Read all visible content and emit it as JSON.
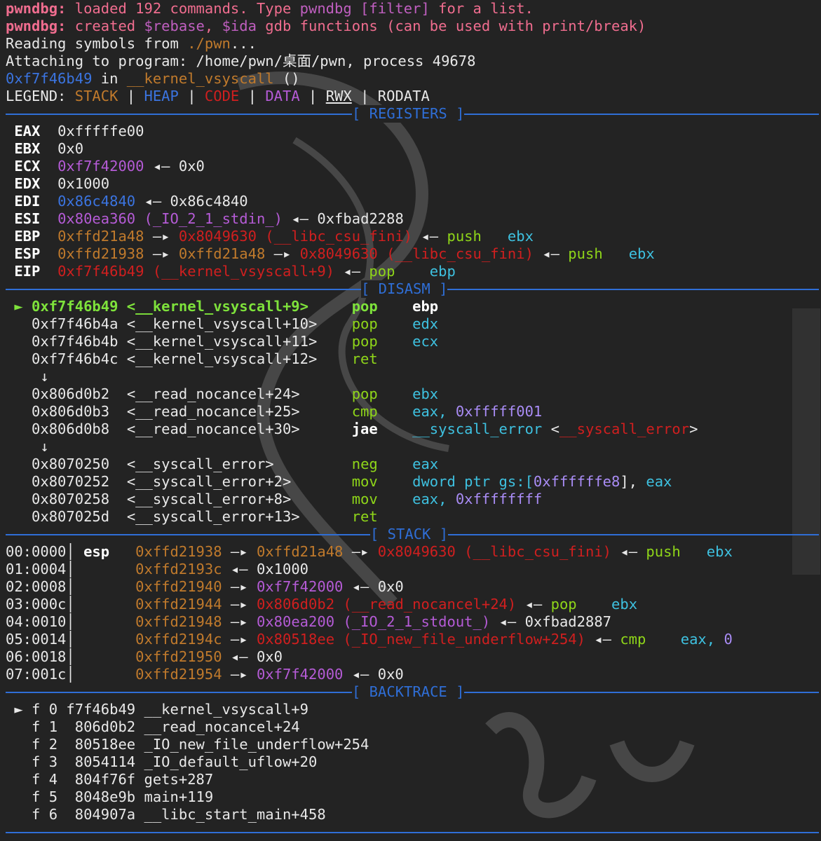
{
  "colors": {
    "background": "#232323",
    "separator": "#2f6ed6",
    "stack": "#c07a2c",
    "heap": "#3b74e0",
    "code": "#d01f1f",
    "data": "#b55bd6",
    "current": "#7ee23b"
  },
  "header": {
    "l1_prompt": "pwndbg:",
    "l1_a": " loaded 192 commands. Type ",
    "l1_b": "pwndbg [filter]",
    "l1_c": " for a list.",
    "l2_prompt": "pwndbg:",
    "l2_a": " created ",
    "l2_b": "$rebase",
    "l2_c": ", ",
    "l2_d": "$ida",
    "l2_e": " gdb functions (can be used with print/break)",
    "l3_a": "Reading symbols from ",
    "l3_b": "./pwn",
    "l3_c": "...",
    "l4": "Attaching to program: /home/pwn/桌面/pwn, process 49678",
    "l5_addr": "0xf7f46b49",
    "l5_in": " in ",
    "l5_func": "__kernel_vsyscall",
    "l5_tail": " ()",
    "legend_label": "LEGEND: ",
    "legend_stack": "STACK",
    "legend_heap": "HEAP",
    "legend_code": "CODE",
    "legend_data": "DATA",
    "legend_rwx": "RWX",
    "legend_rodata": "RODATA",
    "legend_sep": " | "
  },
  "sections": {
    "registers": "[ REGISTERS ]",
    "disasm": "[ DISASM ]",
    "stack": "[ STACK ]",
    "backtrace": "[ BACKTRACE ]"
  },
  "registers": {
    "eax": {
      "name": "EAX",
      "val": "0xfffffe00"
    },
    "ebx": {
      "name": "EBX",
      "val": "0x0"
    },
    "ecx": {
      "name": "ECX",
      "val": "0xf7f42000",
      "arrow": " ◂— ",
      "tail": "0x0"
    },
    "edx": {
      "name": "EDX",
      "val": "0x1000"
    },
    "edi": {
      "name": "EDI",
      "val": "0x86c4840",
      "arrow": " ◂— ",
      "tail": "0x86c4840"
    },
    "esi": {
      "name": "ESI",
      "val": "0x80ea360",
      "sym": " (_IO_2_1_stdin_)",
      "arrow": " ◂— ",
      "tail": "0xfbad2288"
    },
    "ebp": {
      "name": "EBP",
      "val": "0xffd21a48",
      "a1": " —▸ ",
      "p1": "0x8049630",
      "sym": " (__libc_csu_fini)",
      "arrow": " ◂— ",
      "op": "push",
      "reg": "ebx"
    },
    "esp": {
      "name": "ESP",
      "val": "0xffd21938",
      "a1": " —▸ ",
      "p1": "0xffd21a48",
      "a2": " —▸ ",
      "p2": "0x8049630",
      "sym": " (__libc_csu_fini)",
      "arrow": " ◂— ",
      "op": "push",
      "reg": "ebx"
    },
    "eip": {
      "name": "EIP",
      "val": "0xf7f46b49",
      "sym": " (__kernel_vsyscall+9)",
      "arrow": " ◂— ",
      "op": "pop",
      "reg": "ebp"
    }
  },
  "disasm": {
    "marker": "►",
    "down": "↓",
    "rows": [
      {
        "addr": "0xf7f46b49",
        "sym": "<__kernel_vsyscall+9>",
        "op": "pop",
        "args": "ebp"
      },
      {
        "addr": "0xf7f46b4a",
        "sym": "<__kernel_vsyscall+10>",
        "op": "pop",
        "args": "edx"
      },
      {
        "addr": "0xf7f46b4b",
        "sym": "<__kernel_vsyscall+11>",
        "op": "pop",
        "args": "ecx"
      },
      {
        "addr": "0xf7f46b4c",
        "sym": "<__kernel_vsyscall+12>",
        "op": "ret",
        "args": ""
      },
      {
        "addr": "0x806d0b2",
        "sym": "<__read_nocancel+24>",
        "op": "pop",
        "args": "ebx"
      },
      {
        "addr": "0x806d0b3",
        "sym": "<__read_nocancel+25>",
        "op": "cmp",
        "args": "eax,",
        "imm": "0xfffff001"
      },
      {
        "addr": "0x806d0b8",
        "sym": "<__read_nocancel+30>",
        "op": "jae",
        "args": "__syscall_error",
        "t1": " <",
        "target": "__syscall_error",
        "t2": ">"
      },
      {
        "addr": "0x8070250",
        "sym": "<__syscall_error>",
        "op": "neg",
        "args": "eax"
      },
      {
        "addr": "0x8070252",
        "sym": "<__syscall_error+2>",
        "op": "mov",
        "args": "dword ptr gs:[",
        "imm": "0xffffffe8",
        "tail": "], ",
        "reg": "eax"
      },
      {
        "addr": "0x8070258",
        "sym": "<__syscall_error+8>",
        "op": "mov",
        "args": "eax,",
        "imm": "0xffffffff"
      },
      {
        "addr": "0x807025d",
        "sym": "<__syscall_error+13>",
        "op": "ret",
        "args": ""
      }
    ]
  },
  "stack": {
    "esp_label": "esp",
    "rows": [
      {
        "idx": "00:0000",
        "addr": "0xffd21938",
        "a1": " —▸ ",
        "p1": "0xffd21a48",
        "a2": " —▸ ",
        "p2": "0x8049630",
        "sym": " (__libc_csu_fini)",
        "arrow": " ◂— ",
        "op": "push",
        "reg": "ebx"
      },
      {
        "idx": "01:0004",
        "addr": "0xffd2193c",
        "arrow": " ◂— ",
        "tail": "0x1000"
      },
      {
        "idx": "02:0008",
        "addr": "0xffd21940",
        "a1": " —▸ ",
        "p1": "0xf7f42000",
        "arrow": " ◂— ",
        "tail": "0x0"
      },
      {
        "idx": "03:000c",
        "addr": "0xffd21944",
        "a1": " —▸ ",
        "p1": "0x806d0b2",
        "sym": " (__read_nocancel+24)",
        "arrow": " ◂— ",
        "op": "pop",
        "reg": "ebx"
      },
      {
        "idx": "04:0010",
        "addr": "0xffd21948",
        "a1": " —▸ ",
        "p1": "0x80ea200",
        "sym": " (_IO_2_1_stdout_)",
        "arrow": " ◂— ",
        "tail": "0xfbad2887"
      },
      {
        "idx": "05:0014",
        "addr": "0xffd2194c",
        "a1": " —▸ ",
        "p1": "0x80518ee",
        "sym": " (_IO_new_file_underflow+254)",
        "arrow": " ◂— ",
        "op": "cmp",
        "reg": "eax,",
        "imm": "0"
      },
      {
        "idx": "06:0018",
        "addr": "0xffd21950",
        "arrow": " ◂— ",
        "tail": "0x0"
      },
      {
        "idx": "07:001c",
        "addr": "0xffd21954",
        "a1": " —▸ ",
        "p1": "0xf7f42000",
        "arrow": " ◂— ",
        "tail": "0x0"
      }
    ]
  },
  "backtrace": {
    "rows": [
      {
        "text": "f 0 f7f46b49 __kernel_vsyscall+9"
      },
      {
        "text": "f 1  806d0b2 __read_nocancel+24"
      },
      {
        "text": "f 2  80518ee _IO_new_file_underflow+254"
      },
      {
        "text": "f 3  8054114 _IO_default_uflow+20"
      },
      {
        "text": "f 4  804f76f gets+287"
      },
      {
        "text": "f 5  8048e9b main+119"
      },
      {
        "text": "f 6  804907a __libc_start_main+458"
      }
    ]
  }
}
